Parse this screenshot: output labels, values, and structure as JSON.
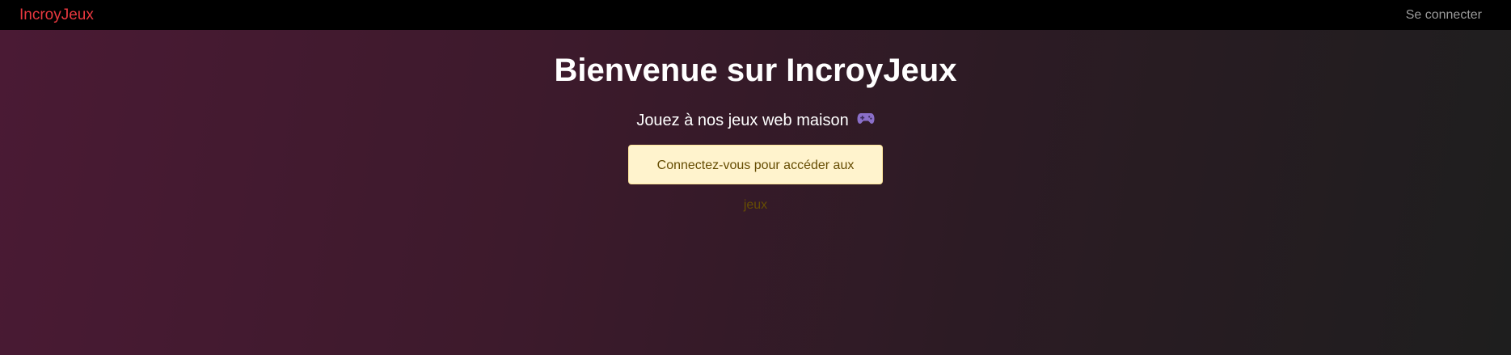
{
  "navbar": {
    "brand": "IncroyJeux",
    "login_label": "Se connecter"
  },
  "hero": {
    "title": "Bienvenue sur IncroyJeux",
    "subtitle": "Jouez à nos jeux web maison",
    "subtitle_icon": "gamepad-icon",
    "alert": "Connectez-vous pour accéder aux jeux"
  },
  "colors": {
    "brand": "#e8383f",
    "navbar_bg": "#000000",
    "alert_bg": "#fff3cd",
    "alert_text": "#664d03",
    "gradient_start": "#4a1a34",
    "gradient_end": "#1e1e1e"
  }
}
